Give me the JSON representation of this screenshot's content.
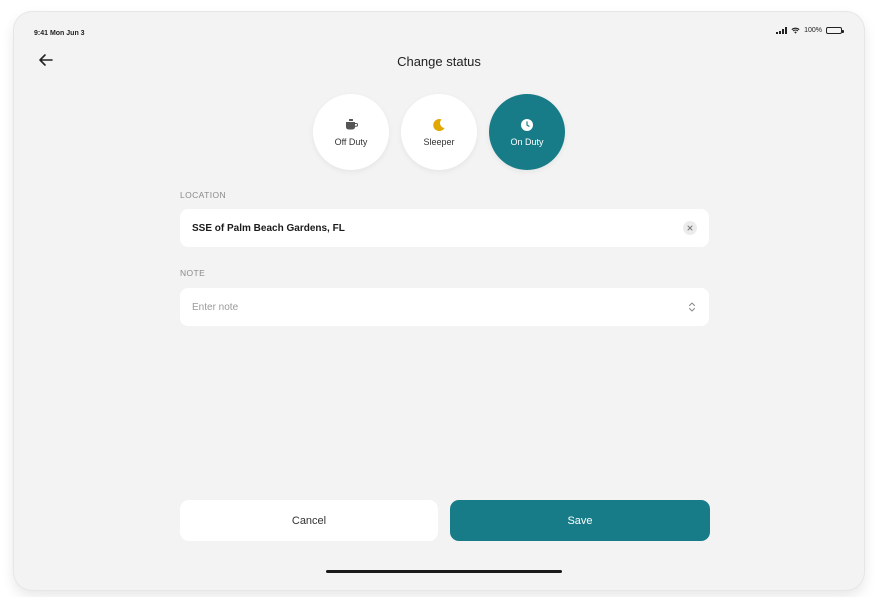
{
  "status_bar": {
    "time": "9:41 Mon Jun 3",
    "battery_text": "100%"
  },
  "header": {
    "title": "Change status",
    "back_icon": "arrow-left-icon"
  },
  "status_options": [
    {
      "label": "Off Duty",
      "icon": "coffee-cup-icon",
      "icon_color": "#555555",
      "selected": false
    },
    {
      "label": "Sleeper",
      "icon": "moon-icon",
      "icon_color": "#e0a800",
      "selected": false
    },
    {
      "label": "On Duty",
      "icon": "clock-icon",
      "icon_color": "#ffffff",
      "selected": true
    }
  ],
  "location": {
    "label": "LOCATION",
    "value": "SSE of Palm Beach Gardens, FL",
    "placeholder": ""
  },
  "note": {
    "label": "NOTE",
    "value": "",
    "placeholder": "Enter note"
  },
  "actions": {
    "cancel_label": "Cancel",
    "save_label": "Save"
  },
  "colors": {
    "accent": "#187c88",
    "background": "#f3f3f3",
    "sleeper_yellow": "#e0a800"
  }
}
